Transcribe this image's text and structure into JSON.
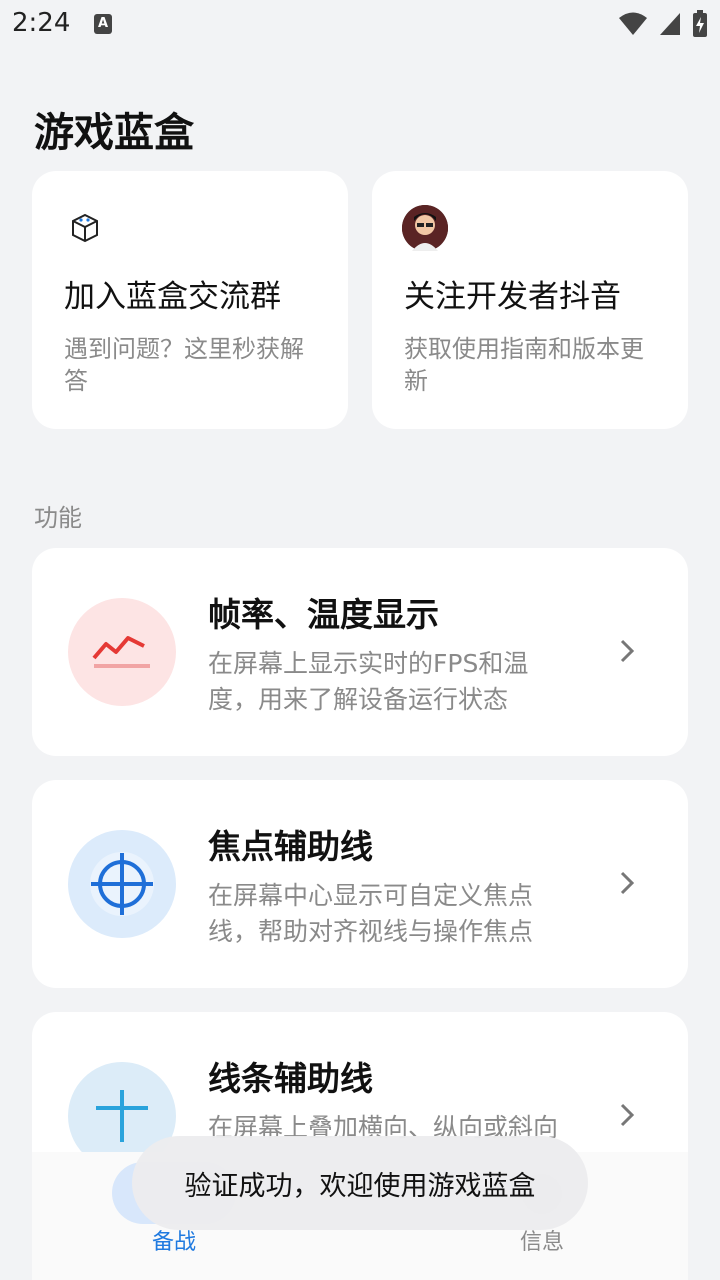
{
  "status_bar": {
    "time": "2:24",
    "notification_icon": "A"
  },
  "page_title": "游戏蓝盒",
  "top_cards": [
    {
      "title": "加入蓝盒交流群",
      "desc": "遇到问题？这里秒获解答",
      "icon": "cube-icon"
    },
    {
      "title": "关注开发者抖音",
      "desc": "获取使用指南和版本更新",
      "icon": "developer-avatar"
    }
  ],
  "section_label": "功能",
  "features": [
    {
      "title": "帧率、温度显示",
      "desc": "在屏幕上显示实时的FPS和温度，用来了解设备运行状态",
      "icon": "fps-chart-icon",
      "icon_bg": "#fde4e4",
      "icon_color": "#e53935"
    },
    {
      "title": "焦点辅助线",
      "desc": "在屏幕中心显示可自定义焦点线，帮助对齐视线与操作焦点",
      "icon": "crosshair-icon",
      "icon_bg": "#dcebfb",
      "icon_color": "#1f6fd8"
    },
    {
      "title": "线条辅助线",
      "desc": "在屏幕上叠加横向、纵向或斜向",
      "icon": "plus-line-icon",
      "icon_bg": "#dcecf8",
      "icon_color": "#2aa3dc"
    }
  ],
  "bottom_nav": {
    "items": [
      {
        "label": "备战",
        "active": true
      },
      {
        "label": "信息",
        "active": false
      }
    ]
  },
  "toast": "验证成功，欢迎使用游戏蓝盒",
  "colors": {
    "accent": "#1f7ae0",
    "background": "#f2f3f5"
  }
}
